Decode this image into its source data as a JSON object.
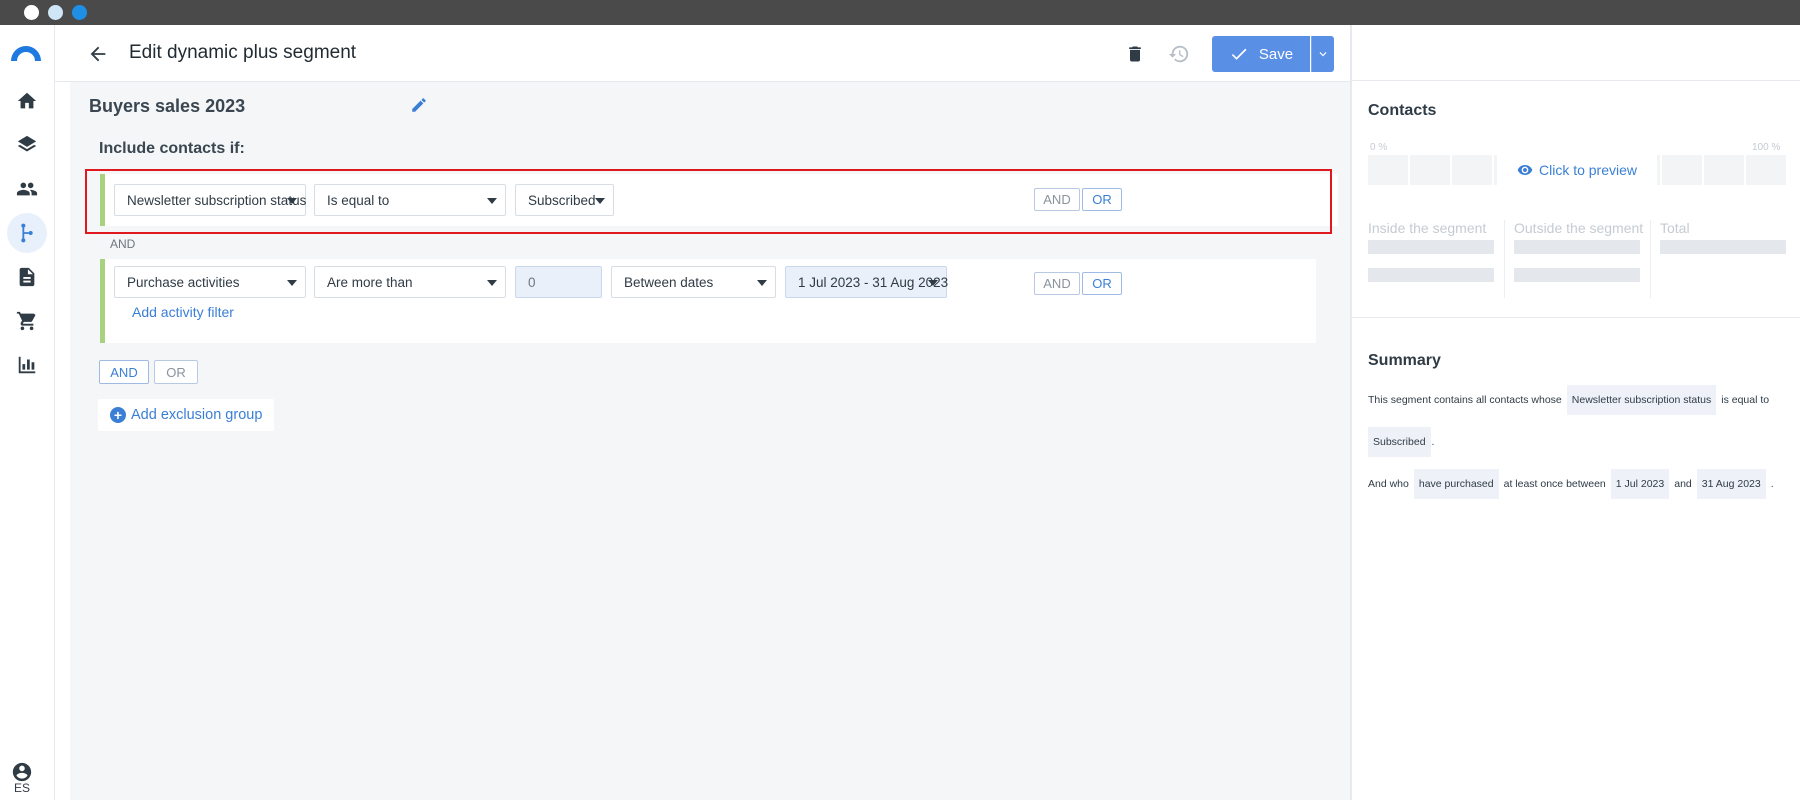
{
  "window": {
    "title_dots": [
      "close",
      "minimize",
      "maximize"
    ]
  },
  "nav": {
    "items": [
      {
        "name": "home-icon"
      },
      {
        "name": "layers-icon"
      },
      {
        "name": "contacts-icon"
      },
      {
        "name": "segments-icon",
        "active": true
      },
      {
        "name": "document-icon"
      },
      {
        "name": "cart-icon"
      },
      {
        "name": "reports-icon"
      }
    ],
    "user_label": "ES"
  },
  "header": {
    "title": "Edit dynamic plus segment",
    "save_label": "Save"
  },
  "segment": {
    "name": "Buyers sales 2023",
    "include_label": "Include contacts if:",
    "condition1": {
      "field": "Newsletter subscription status",
      "operator": "Is equal to",
      "value": "Subscribed",
      "and_label": "AND",
      "or_label": "OR"
    },
    "separator_label": "AND",
    "condition2": {
      "field": "Purchase activities",
      "operator": "Are more than",
      "count_value": "0",
      "date_mode": "Between dates",
      "date_range": "1 Jul 2023 - 31 Aug 2023",
      "add_filter_label": "Add activity filter",
      "and_label": "AND",
      "or_label": "OR"
    },
    "group_and_label": "AND",
    "group_or_label": "OR",
    "add_exclusion_label": "Add exclusion group"
  },
  "contacts_panel": {
    "title": "Contacts",
    "pct_min": "0 %",
    "pct_max": "100 %",
    "preview_label": "Click to preview",
    "inside_label": "Inside the segment",
    "outside_label": "Outside the segment",
    "total_label": "Total"
  },
  "summary": {
    "title": "Summary",
    "line1_prefix": "This segment contains all contacts whose",
    "line1_field": "Newsletter subscription status",
    "line1_operator": "is equal to",
    "line2_value": "Subscribed",
    "line2_suffix": ".",
    "line3_prefix": "And who",
    "line3_action": "have purchased",
    "line3_mid": "at least once between",
    "line3_start": "1 Jul 2023",
    "line3_and": "and",
    "line3_end": "31 Aug 2023",
    "line3_suffix": "."
  },
  "colors": {
    "accent": "#3a7fd5",
    "save_button": "#5a8fe6",
    "highlight": "#e0191f",
    "rule_bar": "#a8d27e"
  }
}
